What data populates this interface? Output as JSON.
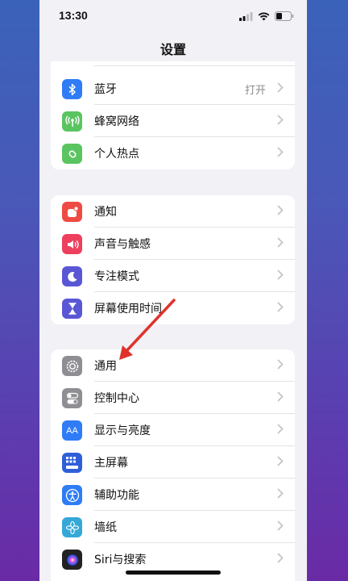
{
  "status": {
    "time": "13:30"
  },
  "nav": {
    "title": "设置"
  },
  "group1": {
    "rows": [
      {
        "label": "蓝牙",
        "value": "打开",
        "icon": "bluetooth-icon",
        "color": "#2f7cf6"
      },
      {
        "label": "蜂窝网络",
        "icon": "cellular-icon",
        "color": "#5ac461"
      },
      {
        "label": "个人热点",
        "icon": "hotspot-icon",
        "color": "#5ac461"
      }
    ]
  },
  "group2": {
    "rows": [
      {
        "label": "通知",
        "icon": "notifications-icon",
        "color": "#ee4b45"
      },
      {
        "label": "声音与触感",
        "icon": "sound-icon",
        "color": "#ee3f5d"
      },
      {
        "label": "专注模式",
        "icon": "moon-icon",
        "color": "#5a57d6"
      },
      {
        "label": "屏幕使用时间",
        "icon": "hourglass-icon",
        "color": "#5a57d6"
      }
    ]
  },
  "group3": {
    "rows": [
      {
        "label": "通用",
        "icon": "gear-icon",
        "color": "#8e8e93"
      },
      {
        "label": "控制中心",
        "icon": "toggles-icon",
        "color": "#8e8e93"
      },
      {
        "label": "显示与亮度",
        "icon": "text-size-icon",
        "color": "#2f7cf6"
      },
      {
        "label": "主屏幕",
        "icon": "home-screen-icon",
        "color": "#2f5fd8"
      },
      {
        "label": "辅助功能",
        "icon": "accessibility-icon",
        "color": "#2f7cf6"
      },
      {
        "label": "墙纸",
        "icon": "wallpaper-icon",
        "color": "#35a8d8"
      },
      {
        "label": "Siri与搜索",
        "icon": "siri-icon",
        "color": "#222222"
      }
    ]
  },
  "icons": {
    "text_size_glyph": "AA"
  },
  "annotation": {
    "color": "#e0322c"
  }
}
